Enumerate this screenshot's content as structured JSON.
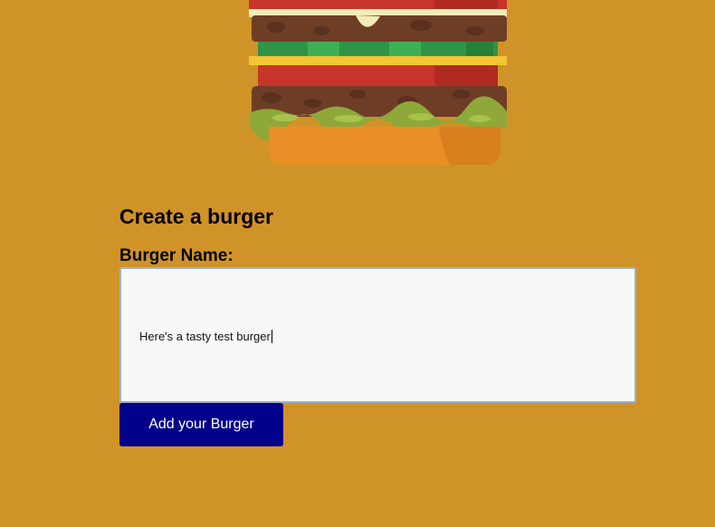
{
  "form": {
    "heading": "Create a burger",
    "name_label": "Burger Name:",
    "name_value": "Here's a tasty test burger",
    "submit_label": "Add your Burger"
  },
  "colors": {
    "background": "#D09328",
    "button": "#00008B",
    "button_text": "#FFFFFF",
    "textarea_bg": "#F8F8F8"
  },
  "icons": {
    "hero": "burger-illustration"
  }
}
